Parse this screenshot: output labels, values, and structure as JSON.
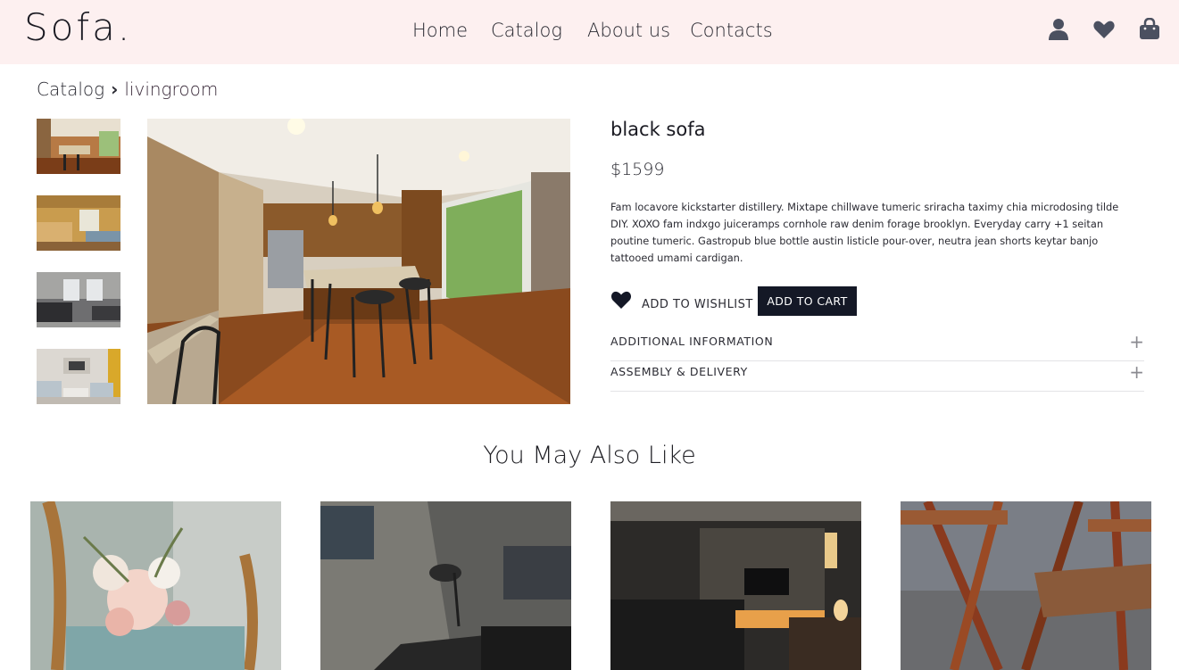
{
  "header": {
    "logo": "Sofa.",
    "nav": [
      "Home",
      "Catalog",
      "About us",
      "Contacts"
    ],
    "icons": [
      "user-icon",
      "heart-icon",
      "shopping-bag-icon"
    ],
    "bg_color": "#fdf0f0"
  },
  "breadcrumb": {
    "root": "Catalog",
    "separator": "›",
    "current": "livingroom"
  },
  "product": {
    "name": "black sofa",
    "price": "$1599",
    "description": "Fam locavore kickstarter distillery. Mixtape chillwave tumeric sriracha taximy chia microdosing tilde DIY. XOXO fam indxgo juiceramps cornhole raw denim forage brooklyn. Everyday carry +1 seitan poutine tumeric. Gastropub blue bottle austin listicle pour-over, neutra jean shorts keytar banjo tattooed umami cardigan.",
    "wishlist_label": "ADD TO WISHLIST",
    "cart_label": "ADD TO CART",
    "accordion": [
      "ADDITIONAL INFORMATION",
      "ASSEMBLY & DELIVERY"
    ],
    "accordion_icon": "+",
    "thumbnails": [
      "kitchen-thumbnail",
      "living-room-thumbnail",
      "grey-living-room-thumbnail",
      "white-living-room-thumbnail"
    ],
    "main_image": "kitchen-with-bar-stools-photo"
  },
  "related": {
    "title": "You May Also Like",
    "cards": [
      "flower-bouquet-on-chair-photo",
      "dark-leather-sofa-photo",
      "dark-living-room-photo",
      "wooden-folding-chairs-photo"
    ]
  },
  "colors": {
    "button_bg": "#141826",
    "text": "#1f1f24"
  }
}
